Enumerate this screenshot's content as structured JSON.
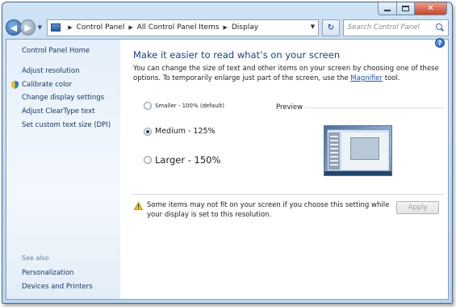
{
  "window": {
    "breadcrumb": [
      "Control Panel",
      "All Control Panel Items",
      "Display"
    ],
    "search_placeholder": "Search Control Panel",
    "icons": {
      "back": "back-arrow-icon",
      "forward": "forward-arrow-icon",
      "refresh": "refresh-icon",
      "search": "search-icon",
      "help": "help-icon"
    }
  },
  "sidebar": {
    "home": "Control Panel Home",
    "items": [
      {
        "label": "Adjust resolution"
      },
      {
        "label": "Calibrate color",
        "icon": "shield-icon"
      },
      {
        "label": "Change display settings"
      },
      {
        "label": "Adjust ClearType text"
      },
      {
        "label": "Set custom text size (DPI)"
      }
    ],
    "see_also_heading": "See also",
    "see_also": [
      {
        "label": "Personalization"
      },
      {
        "label": "Devices and Printers"
      }
    ]
  },
  "main": {
    "title": "Make it easier to read what’s on your screen",
    "description_before": "You can change the size of text and other items on your screen by choosing one of these options. To temporarily enlarge just part of the screen, use the ",
    "description_link": "Magnifier",
    "description_after": " tool.",
    "options": [
      {
        "label": "Smaller - 100% (default)",
        "selected": false
      },
      {
        "label": "Medium - 125%",
        "selected": true
      },
      {
        "label": "Larger - 150%",
        "selected": false
      }
    ],
    "preview_label": "Preview",
    "warning_text": "Some items may not fit on your screen if you choose this setting while your display is set to this resolution.",
    "apply_label": "Apply",
    "colors": {
      "accent": "#1e3f7a",
      "link": "#1f53a8",
      "sidebar_link": "#13345e"
    }
  }
}
